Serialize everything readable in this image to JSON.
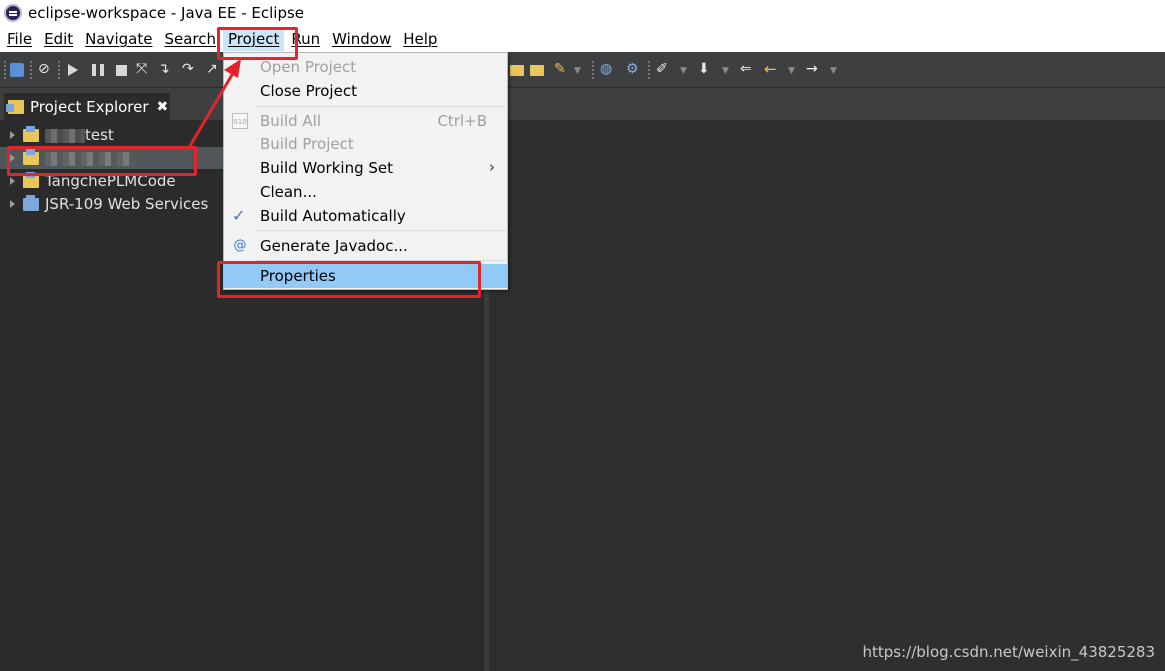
{
  "window": {
    "title": "eclipse-workspace - Java EE - Eclipse"
  },
  "menubar": {
    "items": [
      {
        "label": "File",
        "active": false
      },
      {
        "label": "Edit",
        "active": false
      },
      {
        "label": "Navigate",
        "active": false
      },
      {
        "label": "Search",
        "active": false
      },
      {
        "label": "Project",
        "active": true
      },
      {
        "label": "Run",
        "active": false
      },
      {
        "label": "Window",
        "active": false
      },
      {
        "label": "Help",
        "active": false
      }
    ]
  },
  "project_explorer": {
    "tab_label": "Project Explorer",
    "close_glyph": "✖",
    "items": [
      {
        "label": "test",
        "blurred_prefix": true,
        "selected": false
      },
      {
        "label": "",
        "blurred_prefix": true,
        "selected": true
      },
      {
        "label": "TangchePLMCode",
        "blurred_prefix": false,
        "selected": false
      },
      {
        "label": "JSR-109 Web Services",
        "blurred_prefix": false,
        "selected": false
      }
    ]
  },
  "project_menu": {
    "items": [
      {
        "label": "Open Project",
        "enabled": false,
        "shortcut": "",
        "icon": ""
      },
      {
        "label": "Close Project",
        "enabled": true,
        "shortcut": "",
        "icon": ""
      },
      {
        "label": "Build All",
        "enabled": false,
        "shortcut": "Ctrl+B",
        "icon": "binary-icon"
      },
      {
        "label": "Build Project",
        "enabled": false,
        "shortcut": "",
        "icon": ""
      },
      {
        "label": "Build Working Set",
        "enabled": true,
        "shortcut": "",
        "icon": "",
        "submenu": true
      },
      {
        "label": "Clean...",
        "enabled": true,
        "shortcut": "",
        "icon": ""
      },
      {
        "label": "Build Automatically",
        "enabled": true,
        "shortcut": "",
        "icon": "check-icon",
        "checked": true
      },
      {
        "label": "Generate Javadoc...",
        "enabled": true,
        "shortcut": "",
        "icon": "javadoc-icon"
      },
      {
        "label": "Properties",
        "enabled": true,
        "shortcut": "",
        "icon": "",
        "highlighted": true
      }
    ],
    "submenu_glyph": "›",
    "check_glyph": "✓",
    "binary_glyph": "010",
    "javadoc_glyph": "@"
  },
  "annotation": {
    "color": "#e0252b"
  },
  "colors": {
    "highlight": "#91c9f7",
    "menu_active": "#cce4f7",
    "dark_bg": "#2b2b2b",
    "toolbar_bg": "#3d3f41"
  },
  "watermark": "https://blog.csdn.net/weixin_43825283"
}
